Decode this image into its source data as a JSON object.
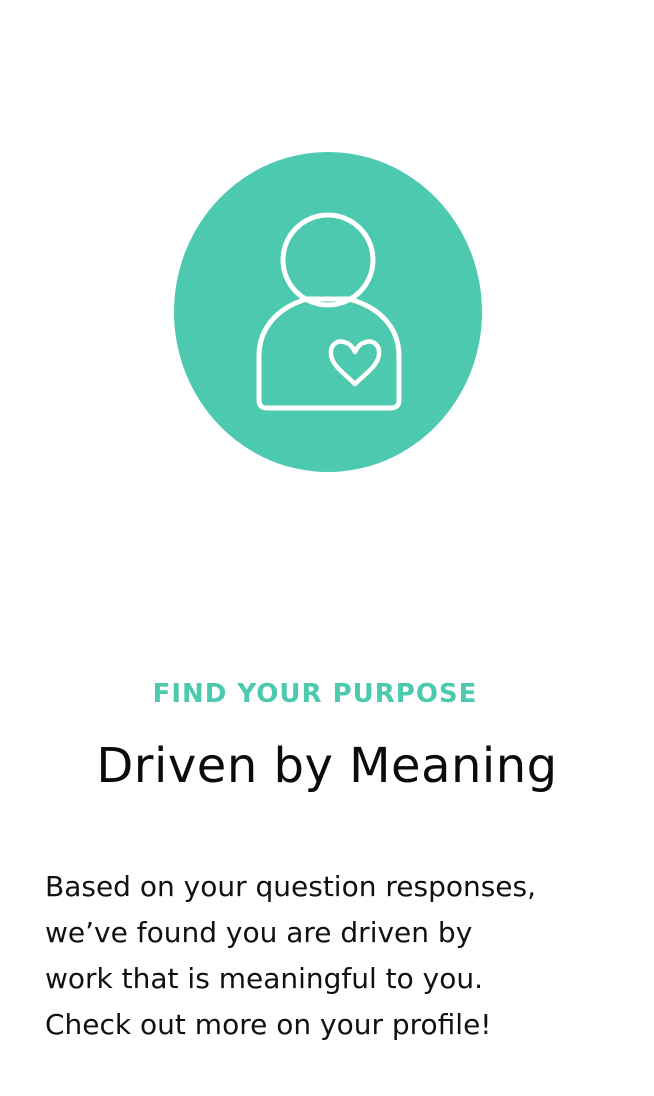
{
  "hero": {
    "icon": "person-heart-icon",
    "circle_color": "#4cc9ae",
    "icon_color": "#ffffff"
  },
  "eyebrow": "FIND YOUR PURPOSE",
  "title": "Driven by Meaning",
  "body_lines": [
    "Based on your question responses,",
    "we’ve found you are driven by",
    "work that is meaningful to you.",
    "Check out more on your profile!"
  ],
  "colors": {
    "accent": "#4cc9ae",
    "title": "#0b0b0b",
    "body": "#111111",
    "background": "#ffffff"
  }
}
